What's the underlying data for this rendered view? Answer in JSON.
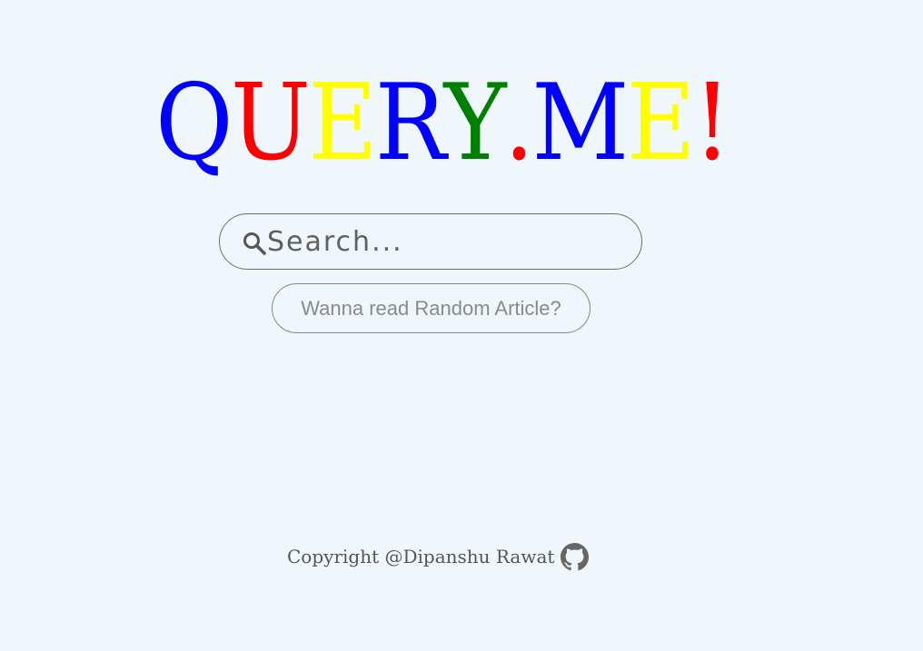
{
  "logo": {
    "letters": [
      {
        "char": "Q",
        "color": "#0000ff"
      },
      {
        "char": "U",
        "color": "#ff0000"
      },
      {
        "char": "E",
        "color": "#ffff00"
      },
      {
        "char": "R",
        "color": "#0000ff"
      },
      {
        "char": "Y",
        "color": "#008000"
      },
      {
        "char": ".",
        "color": "#ff0000"
      },
      {
        "char": "M",
        "color": "#0000ff"
      },
      {
        "char": "E",
        "color": "#ffff00"
      },
      {
        "char": "!",
        "color": "#ff0000"
      }
    ]
  },
  "search": {
    "placeholder": "Search...",
    "value": "",
    "icon": "search-icon"
  },
  "random_button": {
    "label": "Wanna read Random Article?"
  },
  "footer": {
    "copyright": "Copyright @Dipanshu Rawat",
    "icon": "github-icon"
  },
  "colors": {
    "background": "#eff7fd",
    "text": "#555555"
  }
}
